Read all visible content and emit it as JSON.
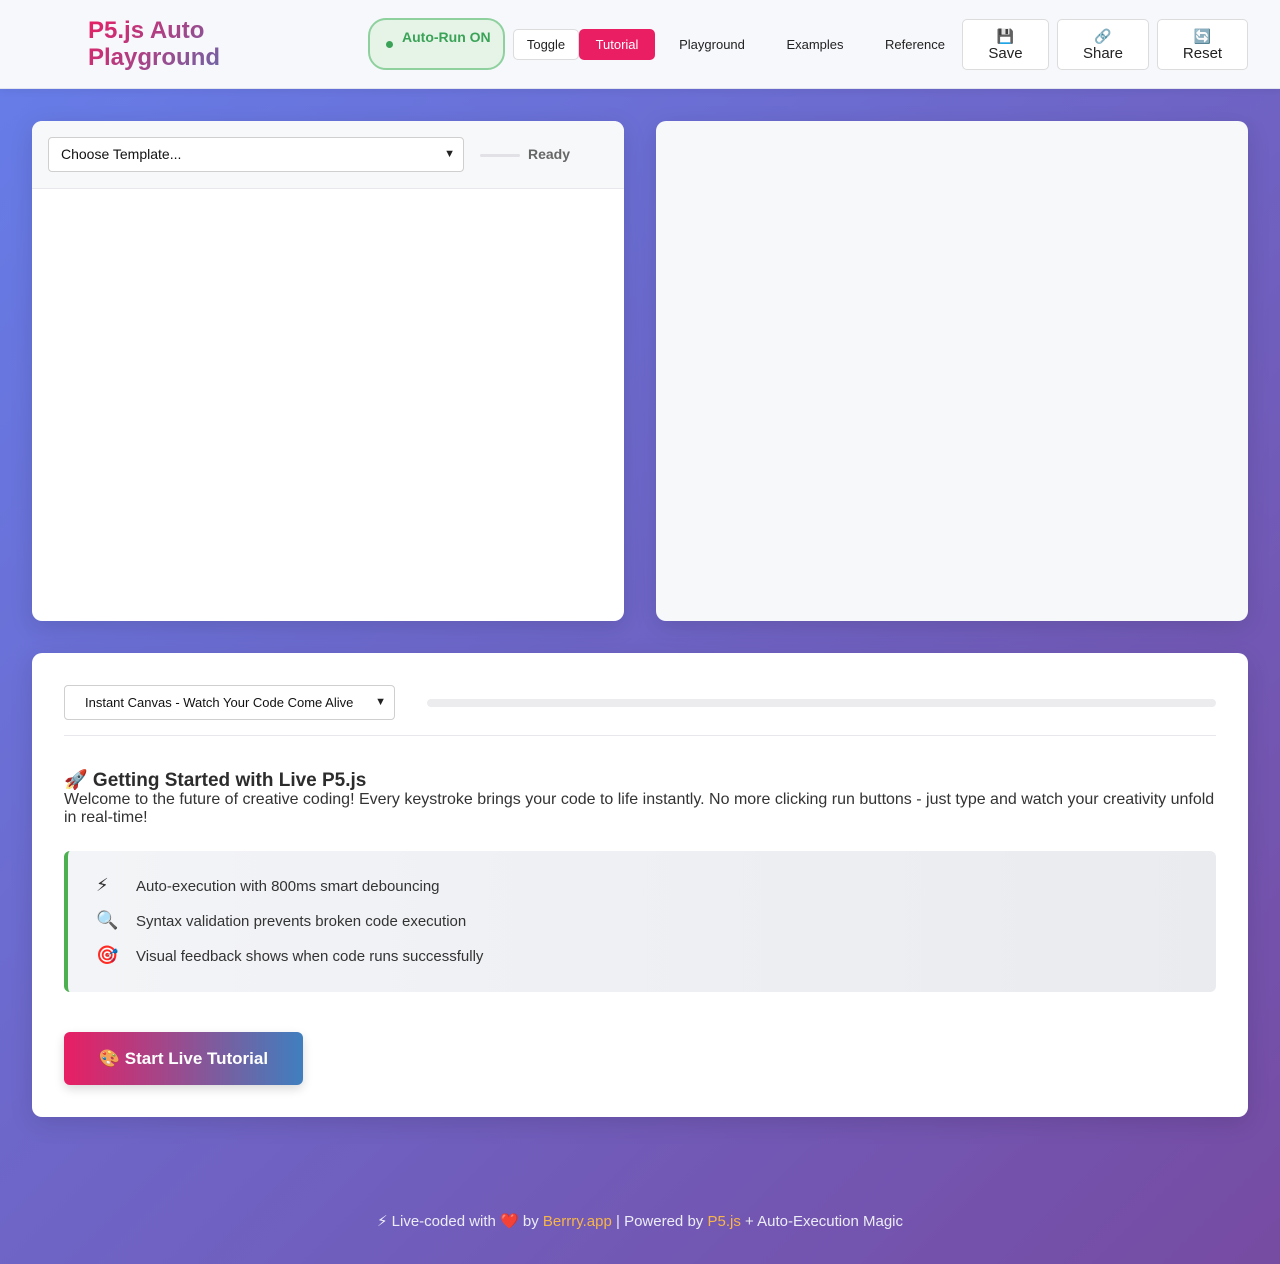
{
  "header": {
    "logo": "P5.js Auto Playground",
    "autorun_label": "Auto-Run ON",
    "toggle_label": "Toggle",
    "tabs": [
      {
        "label": "Tutorial",
        "active": true
      },
      {
        "label": "Playground",
        "active": false
      },
      {
        "label": "Examples",
        "active": false
      },
      {
        "label": "Reference",
        "active": false
      }
    ],
    "actions": [
      {
        "icon": "💾",
        "icon_name": "save-icon",
        "label": "Save"
      },
      {
        "icon": "🔗",
        "icon_name": "link-icon",
        "label": "Share"
      },
      {
        "icon": "🔄",
        "icon_name": "refresh-icon",
        "label": "Reset"
      }
    ]
  },
  "editor": {
    "template_select": "Choose Template...",
    "status": "Ready"
  },
  "tutorial": {
    "select": "Instant Canvas - Watch Your Code Come Alive",
    "progress_percent": 0,
    "title": "🚀 Getting Started with Live P5.js",
    "description": "Welcome to the future of creative coding! Every keystroke brings your code to life instantly. No more clicking run buttons - just type and watch your creativity unfold in real-time!",
    "features": [
      {
        "icon": "⚡",
        "icon_name": "lightning-icon",
        "text": "Auto-execution with 800ms smart debouncing"
      },
      {
        "icon": "🔍",
        "icon_name": "magnifier-icon",
        "text": "Syntax validation prevents broken code execution"
      },
      {
        "icon": "🎯",
        "icon_name": "target-icon",
        "text": "Visual feedback shows when code runs successfully"
      }
    ],
    "start_button": "🎨 Start Live Tutorial"
  },
  "footer": {
    "prefix": "⚡ Live-coded with ❤️ by ",
    "link1": "Berrry.app",
    "middle": " | Powered by ",
    "link2": "P5.js",
    "suffix": " + Auto-Execution Magic"
  },
  "colors": {
    "accent": "#e91e63",
    "blue": "#3f7fbf",
    "success": "#3aa357",
    "bg_start": "#667eea",
    "bg_end": "#764ba2"
  }
}
